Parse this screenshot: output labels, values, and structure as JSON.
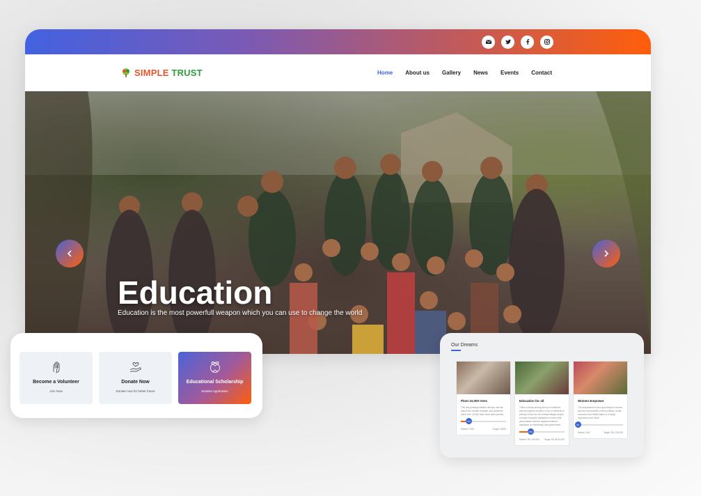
{
  "header": {
    "social_icons": [
      "mail-icon",
      "twitter-icon",
      "facebook-icon",
      "instagram-icon"
    ],
    "logo_part1": "SIMPLE",
    "logo_part2": "TRUST",
    "menu": [
      {
        "label": "Home",
        "active": true
      },
      {
        "label": "About us",
        "active": false
      },
      {
        "label": "Gallery",
        "active": false
      },
      {
        "label": "News",
        "active": false
      },
      {
        "label": "Events",
        "active": false
      },
      {
        "label": "Contact",
        "active": false
      }
    ]
  },
  "hero": {
    "title": "Education",
    "subtitle": "Education is the most powerfull weapon which you can use to change the world"
  },
  "action_cards": [
    {
      "title": "Become a Volunteer",
      "subtitle": "Join Now",
      "icon": "hand-heart-icon"
    },
    {
      "title": "Donate Now",
      "subtitle": "Donate now for better future",
      "icon": "donate-hand-icon"
    },
    {
      "title": "Educational Scholarship",
      "subtitle": "Student Application",
      "icon": "scholarship-icon"
    }
  ],
  "dreams": {
    "title": "Our Dreams",
    "items": [
      {
        "title": "Plant 10,000 trees",
        "desc": "This tree-planting initiative develop rain fall, absorb the climate changes, and grows the future tree. 18,000 trees have been planted.",
        "progress_label": "17%",
        "progress": 0.17,
        "raised": "Raised: 7200",
        "target": "Target: 94000"
      },
      {
        "title": "Education for all",
        "desc": "There is family among the top of childrens and the highest numbers of out of childrens in primary school for the underprivileged people to make education available for every child, personalised with the targeted national standards on elementary and government.",
        "progress_label": "25%",
        "progress": 0.25,
        "raised": "Raised: Rs 1,50,000",
        "target": "Target: Rs 35,00,000"
      },
      {
        "title": "Women Empower",
        "desc": "The empowerment and opportunity of women and the improvement of their political, social, economic and health status is a highly important end in itself.",
        "progress_label": "0%",
        "progress": 0.0,
        "raised": "Raised: Rs 0",
        "target": "Target: Rs 1,50,000"
      }
    ]
  },
  "colors": {
    "gradient_start": "#4262e0",
    "gradient_end": "#ff5e0a",
    "nav_active": "#3a66d8",
    "logo_orange": "#e2562a",
    "logo_green": "#2e9c3d"
  }
}
